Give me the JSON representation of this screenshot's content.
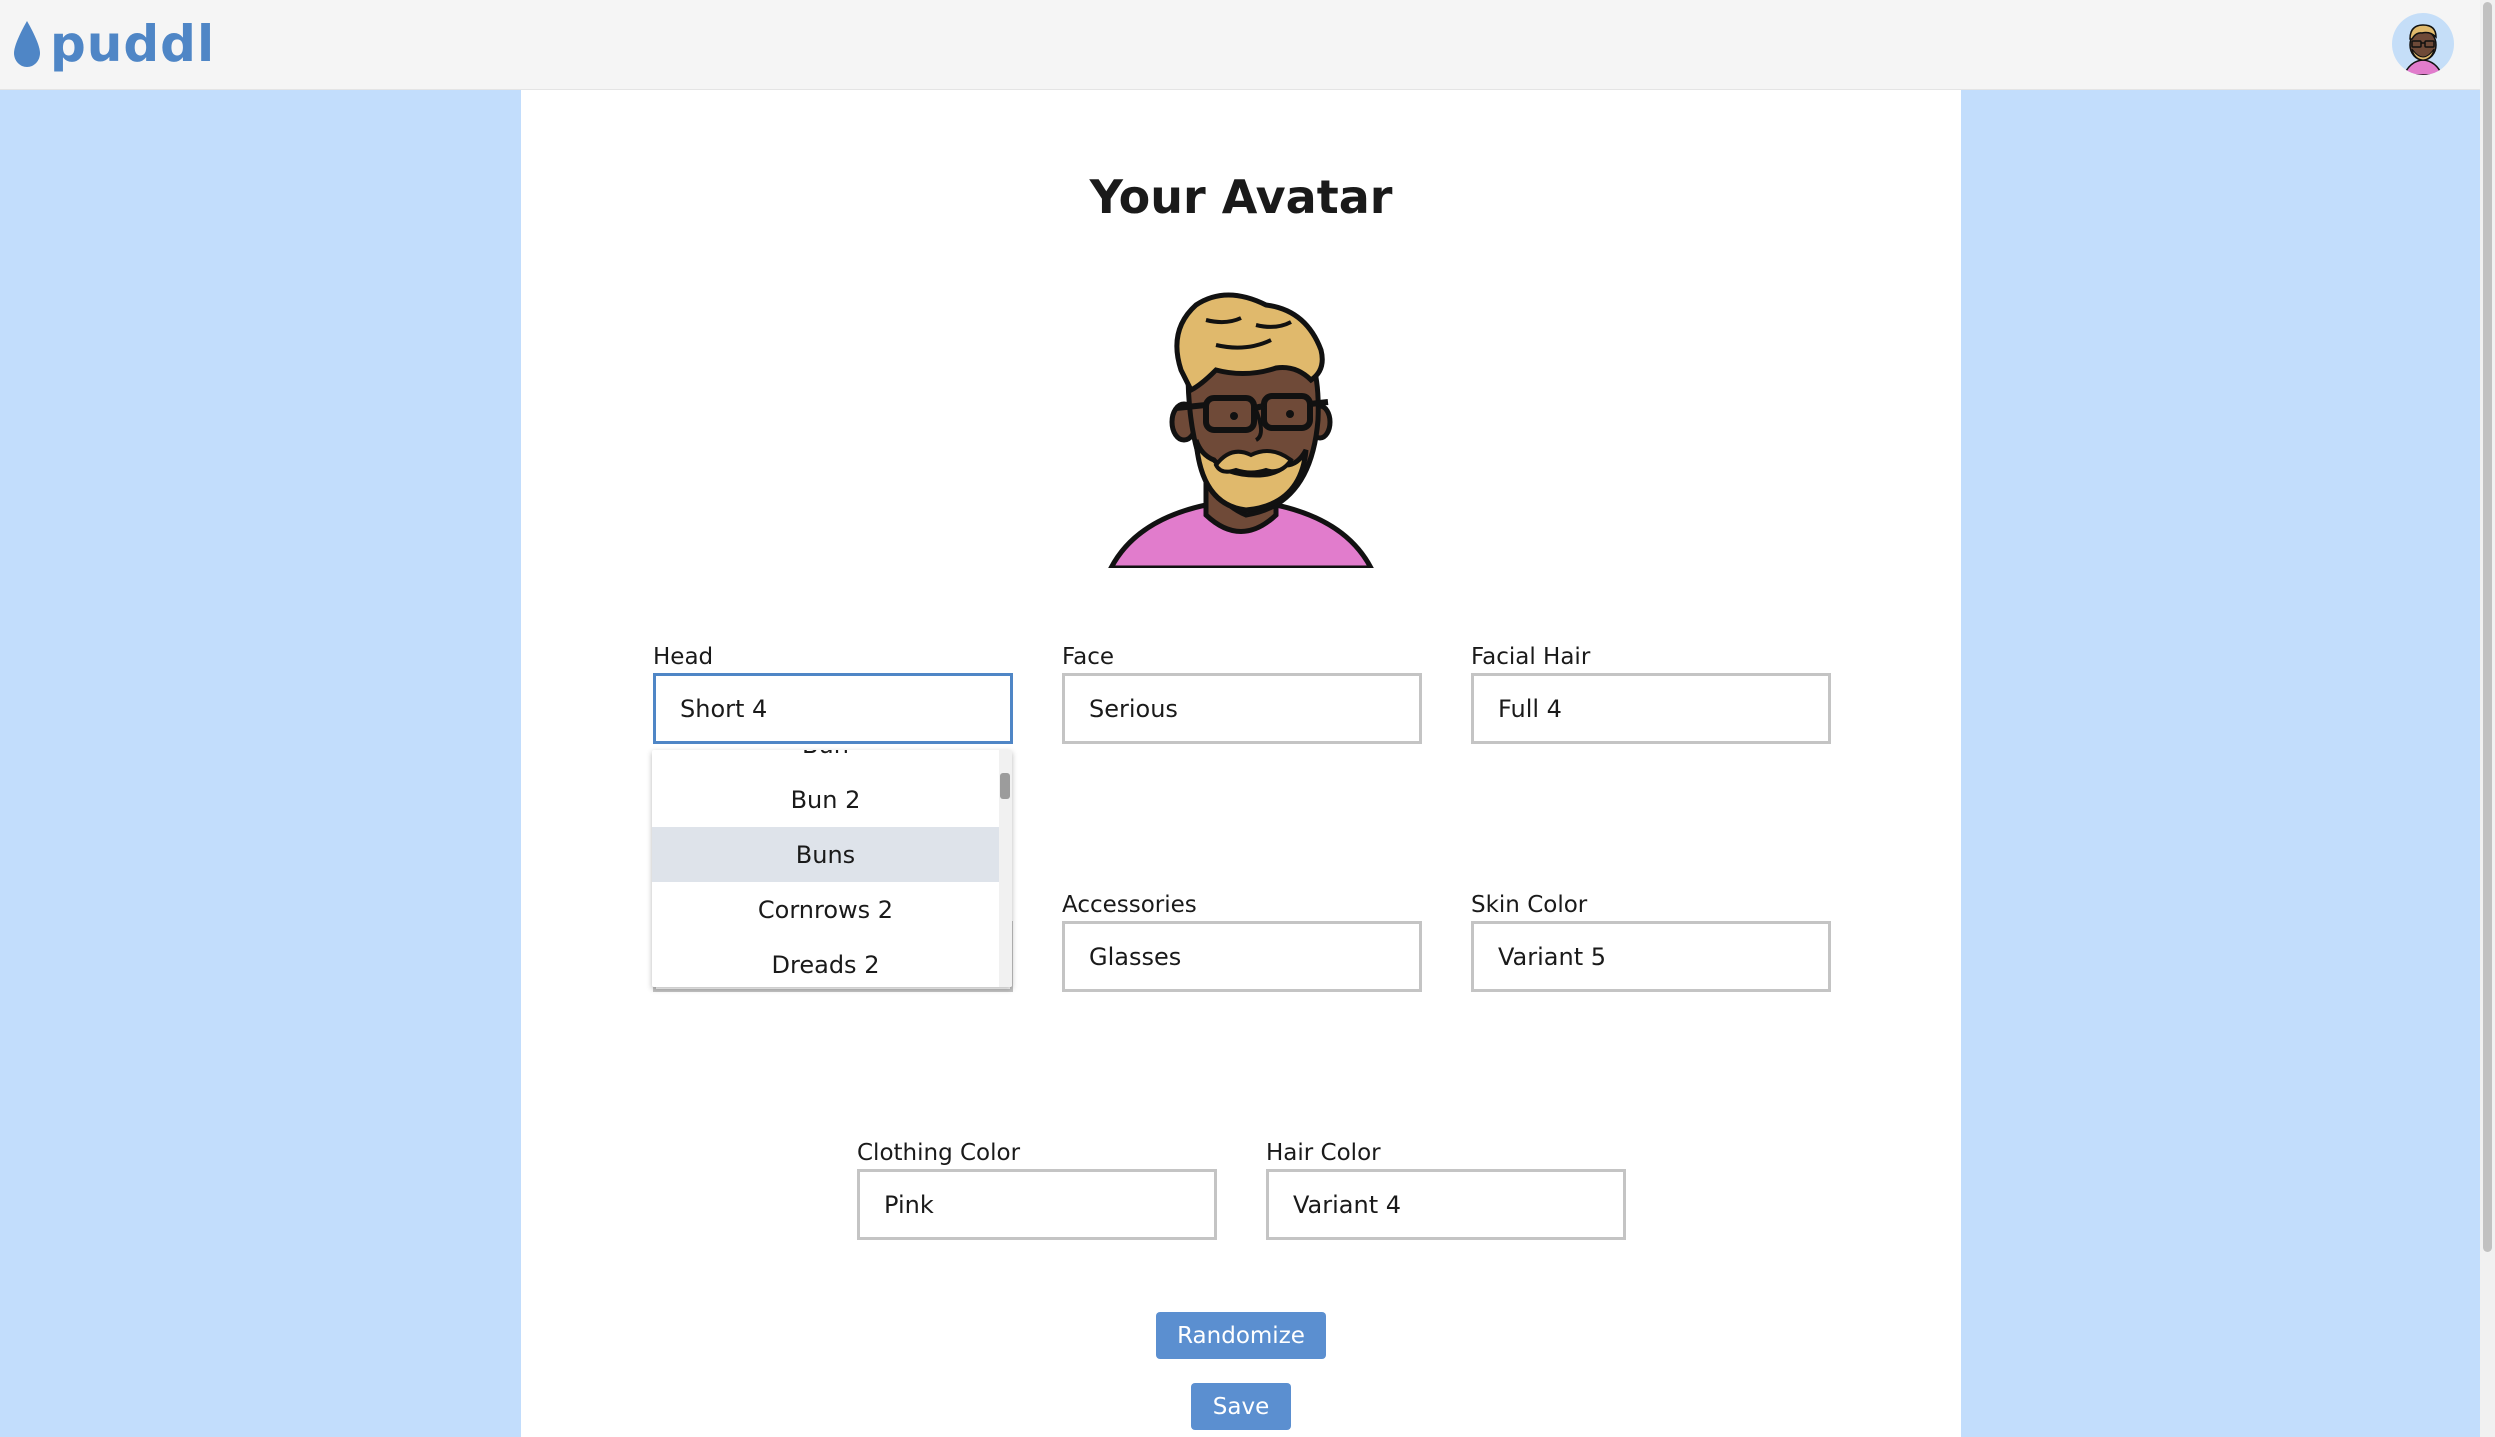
{
  "app": {
    "name": "puddl",
    "brand_color": "#4f86c6"
  },
  "page": {
    "title": "Your Avatar"
  },
  "fields": {
    "head": {
      "label": "Head",
      "value": "Short 4"
    },
    "face": {
      "label": "Face",
      "value": "Serious"
    },
    "facial_hair": {
      "label": "Facial Hair",
      "value": "Full 4"
    },
    "accessories": {
      "label": "Accessories",
      "value": "Glasses"
    },
    "skin_color": {
      "label": "Skin Color",
      "value": "Variant 5"
    },
    "clothing_color": {
      "label": "Clothing Color",
      "value": "Pink"
    },
    "hair_color": {
      "label": "Hair Color",
      "value": "Variant 4"
    }
  },
  "head_dropdown": {
    "options": [
      "Bun",
      "Bun 2",
      "Buns",
      "Cornrows 2",
      "Dreads 2"
    ],
    "highlighted": "Buns"
  },
  "buttons": {
    "randomize": "Randomize",
    "save": "Save"
  },
  "colors": {
    "background": "#c2ddfc",
    "button": "#5b8fd0",
    "shirt": "#e17ccc",
    "skin": "#6f4a38",
    "hair": "#e0b96c"
  }
}
